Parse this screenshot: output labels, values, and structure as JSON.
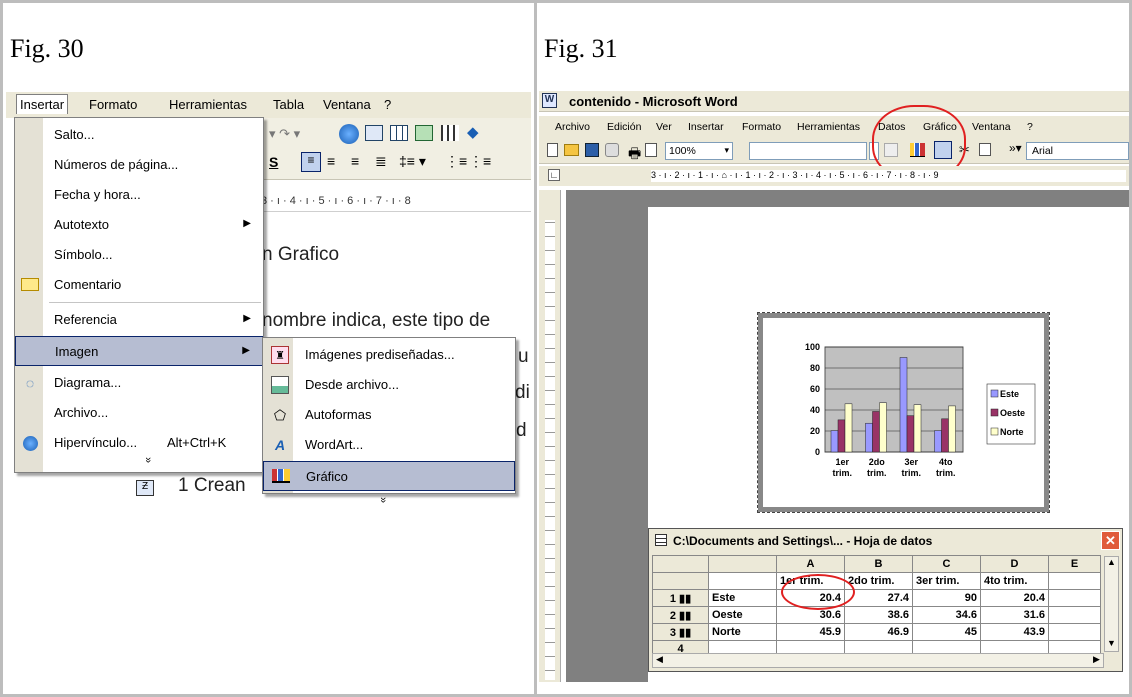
{
  "fig30": {
    "label": "Fig. 30",
    "menubar": [
      "Insertar",
      "Formato",
      "Herramientas",
      "Tabla",
      "Ventana",
      "?"
    ],
    "menu": [
      {
        "label": "Salto...",
        "icon": "none"
      },
      {
        "label": "Números de página...",
        "icon": "none"
      },
      {
        "label": "Fecha y hora...",
        "icon": "none"
      },
      {
        "label": "Autotexto",
        "icon": "none",
        "sub": true
      },
      {
        "label": "Símbolo...",
        "icon": "none"
      },
      {
        "label": "Comentario",
        "icon": "comment-icon"
      },
      {
        "label": "Referencia",
        "icon": "none",
        "sub": true
      },
      {
        "label": "Imagen",
        "icon": "none",
        "sub": true
      },
      {
        "label": "Diagrama...",
        "icon": "diagram-icon"
      },
      {
        "label": "Archivo...",
        "icon": "none"
      },
      {
        "label": "Hipervínculo...",
        "icon": "hyperlink-icon",
        "shortcut": "Alt+Ctrl+K"
      },
      {
        "label": "»",
        "icon": "none"
      }
    ],
    "submenu": [
      {
        "label": "Imágenes prediseñadas...",
        "icon": "clipart-icon"
      },
      {
        "label": "Desde archivo...",
        "icon": "picture-file-icon"
      },
      {
        "label": "Autoformas",
        "icon": "autoshapes-icon"
      },
      {
        "label": "WordArt...",
        "icon": "wordart-icon"
      },
      {
        "label": "Gráfico",
        "icon": "chart-icon"
      },
      {
        "label": "»",
        "icon": "none"
      }
    ],
    "toolbar_zoom": "",
    "ruler_text": "3 · ı · 4 · ı · 5 · ı · 6 · ı · 7 · ı · 8",
    "doc_lines": [
      "n Grafico",
      "nombre indica, este tipo de",
      "u",
      "di",
      "d"
    ],
    "bottom_text": "1   Crean",
    "style_s": "S"
  },
  "fig31": {
    "label": "Fig. 31",
    "title": "contenido - Microsoft Word",
    "menubar": [
      "Archivo",
      "Edición",
      "Ver",
      "Insertar",
      "Formato",
      "Herramientas",
      "Datos",
      "Gráfico",
      "Ventana",
      "?"
    ],
    "zoom": "100%",
    "font": "Arial",
    "ruler": "3 · ı · 2 · ı · 1 · ı · ⌂ · ı · 1 · ı · 2 · ı · 3 · ı · 4 · ı · 5 · ı · 6 · ı · 7 · ı · 8 · ı · 9",
    "datasheet": {
      "title": "C:\\Documents and Settings\\... - Hoja de datos",
      "columns": [
        "A",
        "B",
        "C",
        "D",
        "E"
      ],
      "header_row": [
        "1er trim.",
        "2do trim.",
        "3er trim.",
        "4to trim."
      ],
      "rows": [
        {
          "n": "1",
          "name": "Este",
          "values": [
            "20.4",
            "27.4",
            "90",
            "20.4"
          ]
        },
        {
          "n": "2",
          "name": "Oeste",
          "values": [
            "30.6",
            "38.6",
            "34.6",
            "31.6"
          ]
        },
        {
          "n": "3",
          "name": "Norte",
          "values": [
            "45.9",
            "46.9",
            "45",
            "43.9"
          ]
        },
        {
          "n": "4",
          "name": "",
          "values": [
            "",
            "",
            "",
            ""
          ]
        }
      ]
    }
  },
  "chart_data": {
    "type": "bar",
    "categories": [
      "1er trim.",
      "2do trim.",
      "3er trim.",
      "4to trim."
    ],
    "series": [
      {
        "name": "Este",
        "values": [
          20.4,
          27.4,
          90,
          20.4
        ],
        "color": "#9999ff"
      },
      {
        "name": "Oeste",
        "values": [
          30.6,
          38.6,
          34.6,
          31.6
        ],
        "color": "#993366"
      },
      {
        "name": "Norte",
        "values": [
          45.9,
          46.9,
          45,
          43.9
        ],
        "color": "#ffffcc"
      }
    ],
    "ylim": [
      0,
      100
    ],
    "yticks": [
      0,
      20,
      40,
      60,
      80,
      100
    ],
    "grid": true,
    "legend": "right"
  }
}
